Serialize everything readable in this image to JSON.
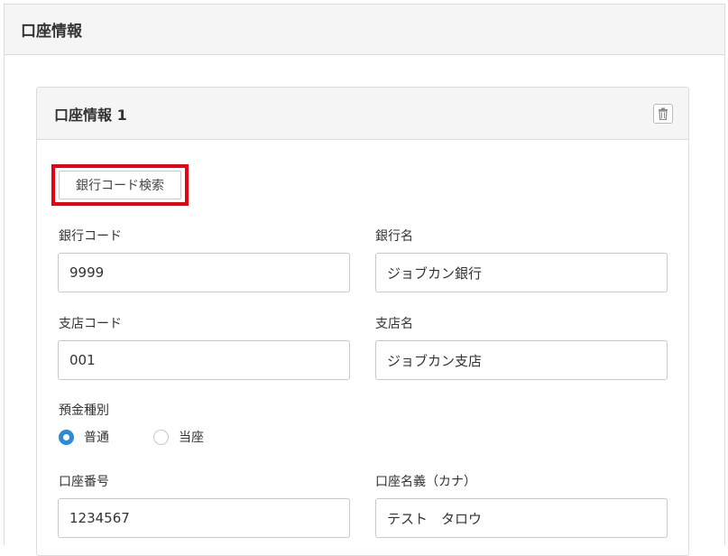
{
  "section": {
    "title": "口座情報"
  },
  "account_card": {
    "title": "口座情報 1",
    "delete_icon": "trash-icon",
    "bank_search_label": "銀行コード検索",
    "bank_code": {
      "label": "銀行コード",
      "value": "9999"
    },
    "bank_name": {
      "label": "銀行名",
      "value": "ジョブカン銀行"
    },
    "branch_code": {
      "label": "支店コード",
      "value": "001"
    },
    "branch_name": {
      "label": "支店名",
      "value": "ジョブカン支店"
    },
    "deposit_type": {
      "label": "預金種別",
      "options": [
        {
          "label": "普通",
          "selected": true
        },
        {
          "label": "当座",
          "selected": false
        }
      ]
    },
    "account_number": {
      "label": "口座番号",
      "value": "1234567"
    },
    "account_holder": {
      "label": "口座名義（カナ）",
      "value": "テスト　タロウ"
    }
  },
  "colors": {
    "highlight": "#e60012",
    "radio_checked": "#2d8ad8",
    "header_bg": "#f5f5f5"
  }
}
